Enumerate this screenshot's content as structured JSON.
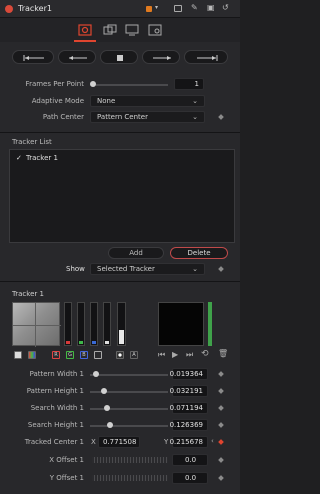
{
  "header": {
    "title": "Tracker1"
  },
  "params": {
    "frames_per_point": {
      "label": "Frames Per Point",
      "value": "1"
    },
    "adaptive_mode": {
      "label": "Adaptive Mode",
      "value": "None"
    },
    "path_center": {
      "label": "Path Center",
      "value": "Pattern Center"
    }
  },
  "tracker_list": {
    "title": "Tracker List",
    "items": [
      {
        "label": "Tracker 1",
        "checked": "✓"
      }
    ],
    "add_label": "Add",
    "delete_label": "Delete",
    "show_label": "Show",
    "show_value": "Selected Tracker"
  },
  "tracker1": {
    "title": "Tracker 1",
    "channel_labels": [
      "R",
      "G",
      "B",
      "A"
    ]
  },
  "fields": {
    "pattern_width": {
      "label": "Pattern Width 1",
      "value": "0.019364"
    },
    "pattern_height": {
      "label": "Pattern Height 1",
      "value": "0.032191"
    },
    "search_width": {
      "label": "Search Width 1",
      "value": "0.071194"
    },
    "search_height": {
      "label": "Search Height 1",
      "value": "0.126369"
    },
    "tracked_center": {
      "label": "Tracked Center 1",
      "x_label": "X",
      "x_value": "0.771508",
      "y_label": "Y",
      "y_value": "0.215678"
    },
    "x_offset": {
      "label": "X Offset 1",
      "value": "0.0"
    },
    "y_offset": {
      "label": "Y Offset 1",
      "value": "0.0"
    }
  },
  "colors": {
    "accent_red": "#e0452f",
    "orange": "#e07a1f",
    "green": "#3fa24a"
  }
}
